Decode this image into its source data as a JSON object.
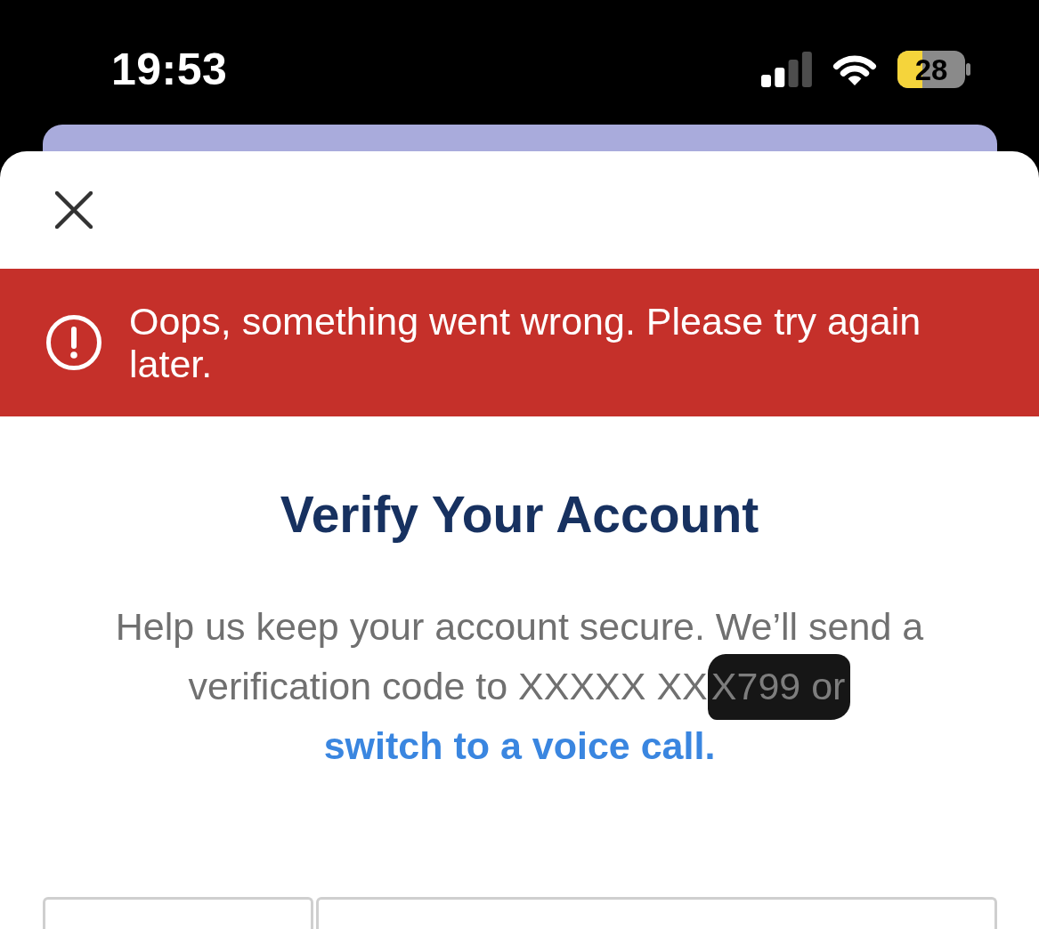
{
  "status_bar": {
    "time": "19:53",
    "battery_percent": "28"
  },
  "error_banner": {
    "message": "Oops, something went wrong. Please try again later."
  },
  "title": "Verify Your Account",
  "description": {
    "text": "Help us keep your account secure. We’ll send a verification code to XXXXX XX",
    "redacted": "X799 or",
    "link": "switch to a voice call."
  },
  "fields": [
    {
      "kind": "narrow"
    },
    {
      "kind": "wide"
    }
  ]
}
